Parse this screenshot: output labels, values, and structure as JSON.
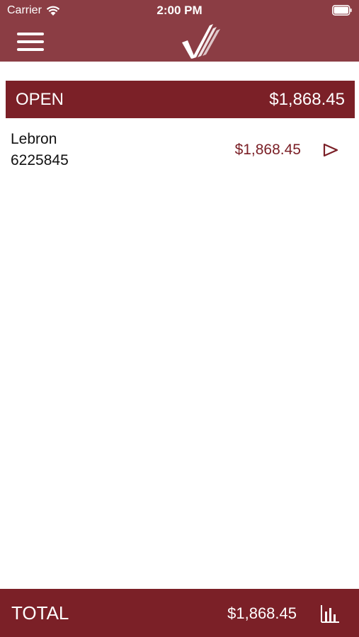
{
  "status_bar": {
    "carrier": "Carrier",
    "time": "2:00 PM",
    "icons": [
      "wifi-icon",
      "battery-icon"
    ]
  },
  "nav": {
    "menu_icon": "hamburger-menu-icon",
    "logo_icon": "checkmark-logo-icon"
  },
  "open_section": {
    "label": "OPEN",
    "total": "$1,868.45",
    "items": [
      {
        "name": "Lebron",
        "id": "6225845",
        "amount": "$1,868.45",
        "action_icon": "play-arrow-icon"
      }
    ]
  },
  "footer": {
    "label": "TOTAL",
    "amount": "$1,868.45",
    "chart_icon": "bar-chart-icon"
  },
  "colors": {
    "header": "#8b3d44",
    "section": "#7b2027",
    "footer": "#7b2027",
    "accent_text": "#7b2027"
  }
}
